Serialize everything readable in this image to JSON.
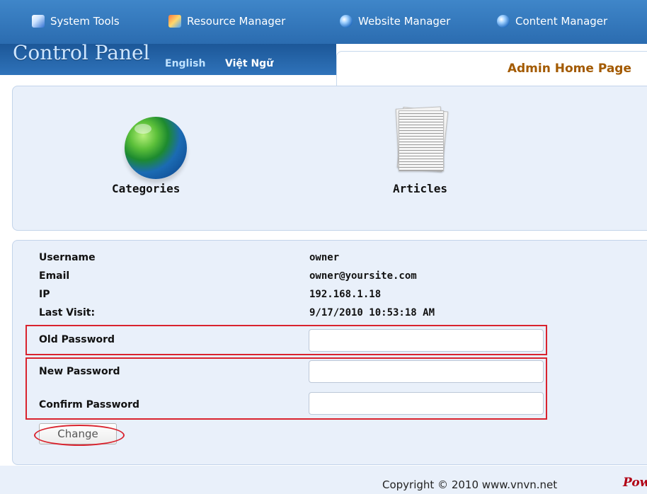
{
  "top_menu": {
    "items": [
      {
        "label": "System Tools",
        "icon": "system-tools-icon"
      },
      {
        "label": "Resource Manager",
        "icon": "resource-manager-icon"
      },
      {
        "label": "Website Manager",
        "icon": "globe-icon"
      },
      {
        "label": "Content Manager",
        "icon": "globe-icon"
      }
    ]
  },
  "header": {
    "logo": "Control Panel",
    "languages": [
      "English",
      "Việt Ngữ"
    ],
    "page_tab": "Admin Home Page"
  },
  "quick_icons": [
    {
      "label": "Categories",
      "icon": "globe-icon"
    },
    {
      "label": "Articles",
      "icon": "document-stack-icon"
    }
  ],
  "user_info": {
    "rows": [
      {
        "label": "Username",
        "value": "owner"
      },
      {
        "label": "Email",
        "value": "owner@yoursite.com"
      },
      {
        "label": "IP",
        "value": "192.168.1.18"
      },
      {
        "label": "Last Visit:",
        "value": "9/17/2010 10:53:18 AM"
      }
    ],
    "old_password_label": "Old Password",
    "new_password_label": "New Password",
    "confirm_password_label": "Confirm Password",
    "old_password_value": "",
    "new_password_value": "",
    "confirm_password_value": "",
    "change_button": "Change"
  },
  "footer": {
    "copyright": "Copyright © 2010 www.vnvn.net",
    "powered": "Powe"
  },
  "colors": {
    "menu_blue": "#2f73ba",
    "panel_bg": "#e9f0fa",
    "highlight_red": "#d9232e",
    "tab_text": "#a35a00"
  }
}
